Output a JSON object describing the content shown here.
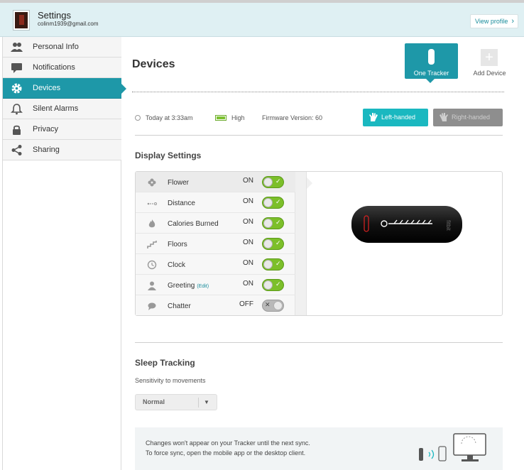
{
  "header": {
    "title": "Settings",
    "email": "colinm1939@gmail.com",
    "view_profile": "View profile",
    "view_profile_chevron": "›"
  },
  "sidebar": {
    "items": [
      {
        "label": "Personal Info",
        "icon": "people-icon"
      },
      {
        "label": "Notifications",
        "icon": "speech-bubble-icon"
      },
      {
        "label": "Devices",
        "icon": "gear-icon",
        "active": true
      },
      {
        "label": "Silent Alarms",
        "icon": "bell-icon"
      },
      {
        "label": "Privacy",
        "icon": "lock-icon"
      },
      {
        "label": "Sharing",
        "icon": "share-icon"
      }
    ]
  },
  "devices": {
    "title": "Devices",
    "tracker_tile_label": "One Tracker",
    "add_device_label": "Add Device",
    "add_device_plus": "+"
  },
  "status": {
    "last_sync": "Today at 3:33am",
    "battery": "High",
    "firmware": "Firmware Version: 60",
    "left_handed": "Left-handed",
    "right_handed": "Right-handed"
  },
  "display_settings": {
    "title": "Display Settings",
    "rows": [
      {
        "name": "Flower",
        "state": "ON",
        "on": true,
        "mark": "✓"
      },
      {
        "name": "Distance",
        "state": "ON",
        "on": true,
        "mark": "✓"
      },
      {
        "name": "Calories Burned",
        "state": "ON",
        "on": true,
        "mark": "✓"
      },
      {
        "name": "Floors",
        "state": "ON",
        "on": true,
        "mark": "✓"
      },
      {
        "name": "Clock",
        "state": "ON",
        "on": true,
        "mark": "✓"
      },
      {
        "name": "Greeting",
        "state": "ON",
        "on": true,
        "mark": "✓",
        "edit": "(Edit)"
      },
      {
        "name": "Chatter",
        "state": "OFF",
        "on": false,
        "mark": "✕"
      }
    ]
  },
  "tracker_brand": "fitbit",
  "sleep": {
    "title": "Sleep Tracking",
    "subtitle": "Sensitivity to movements",
    "selected": "Normal",
    "caret": "▼"
  },
  "notice": {
    "line1": "Changes won't appear on your Tracker until the next sync.",
    "line2": "To force sync, open the mobile app or the desktop client."
  },
  "colors": {
    "accent": "#1e98a8",
    "toggle_on": "#7cbf2a",
    "left_handed_bg": "#1ab8c0",
    "right_handed_bg": "#8e8e8e"
  }
}
